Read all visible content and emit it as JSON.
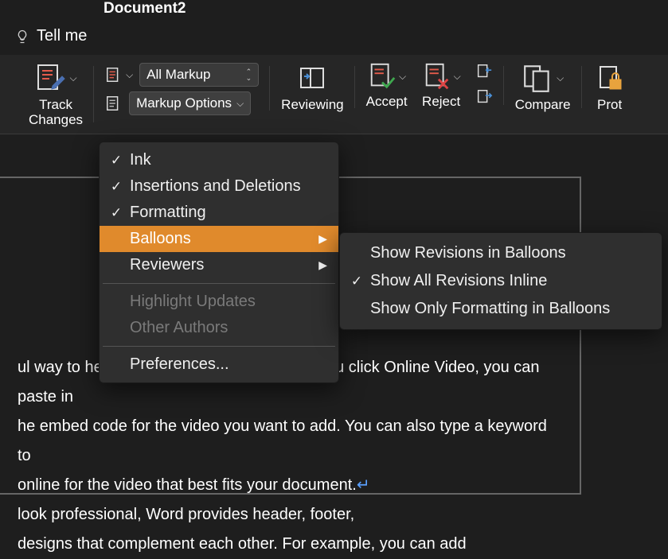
{
  "title": "Document2",
  "tellme": "Tell me",
  "ribbon": {
    "track_changes": "Track\nChanges",
    "display_combo": "All Markup",
    "markup_options": "Markup Options",
    "reviewing": "Reviewing",
    "accept": "Accept",
    "reject": "Reject",
    "compare": "Compare",
    "protect": "Prot"
  },
  "markup_menu": {
    "ink": "Ink",
    "insertions": "Insertions and Deletions",
    "formatting": "Formatting",
    "balloons": "Balloons",
    "reviewers": "Reviewers",
    "highlight_updates": "Highlight Updates",
    "other_authors": "Other Authors",
    "preferences": "Preferences...",
    "checked": {
      "ink": true,
      "insertions": true,
      "formatting": true
    }
  },
  "balloons_submenu": {
    "show_in_balloons": "Show Revisions in Balloons",
    "show_inline": "Show All Revisions Inline",
    "show_formatting_only": "Show Only Formatting in Balloons",
    "checked": "show_inline"
  },
  "document_lines": [
    "ul way to help you prove your point. When you click Online Video, you can paste in",
    "he embed code for the video you want to add. You can also type a keyword to",
    "online for the video that best fits your document.",
    "look professional, Word provides header, footer,",
    "designs that complement each other. For example, you can add"
  ]
}
